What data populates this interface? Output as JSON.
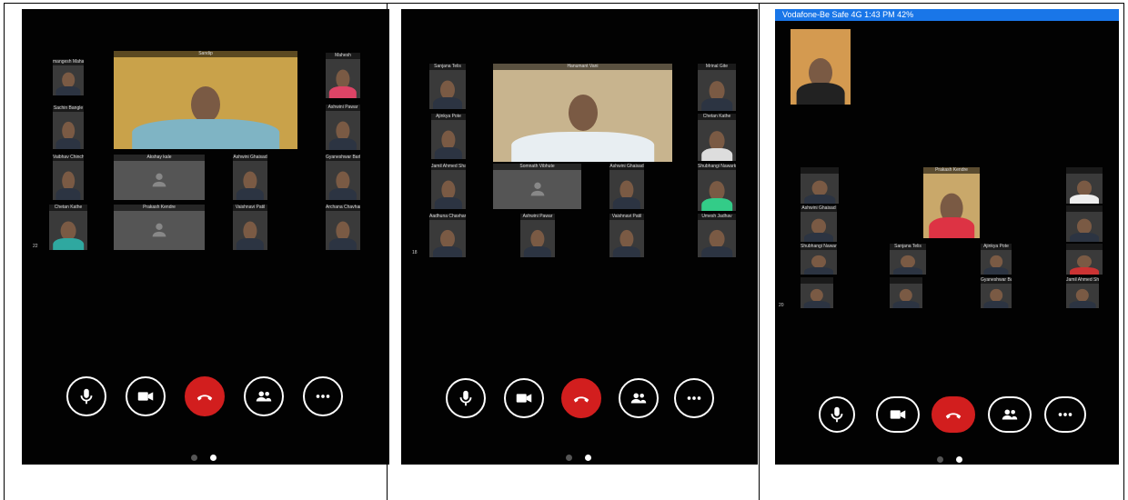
{
  "panels": [
    {
      "id": "p1",
      "main_speaker": "Sandip",
      "participants": [
        "mangesh Mahale",
        "Sachin Bangle",
        "Vaibhav Chinchole",
        "Chetan Kathe",
        "Mahesh",
        "Ashwini Pawar",
        "Gyaneshwar Barkale",
        "Archana Chavhan",
        "Akshay kale",
        "Ashwini Ghaisad",
        "Prakash Kendre",
        "Vaishnavi Patil"
      ],
      "count": "22"
    },
    {
      "id": "p2",
      "main_speaker": "Hanumant Vani",
      "participants": [
        "Sanjana Telis",
        "Mrinal Gite",
        "Ajinkya Pote",
        "Chetan Kathe",
        "Jamil Ahmed Shakh Khalil",
        "Somnath Vibhute",
        "Ashwini Ghaisad",
        "Shubhangi Nawarkhele",
        "Aadhuna Chavhan",
        "Ashwini Pawar",
        "Vaishnavi Patil",
        "Umesh Jadhav"
      ],
      "count": "18"
    },
    {
      "id": "p3",
      "status_bar": "Vodafone-Be Safe  4G  1:43 PM  42%",
      "main_speaker": "Prakash Kendre",
      "participants": [
        "Ashwini Ghaisad",
        "Shubhangi Nawarkhele",
        "Sanjana Telis",
        "Ajinkya Pote",
        "Chetan Kathe",
        "Jamil Ahmed Shakh Khalil",
        "Gyaneshwar Barkale"
      ],
      "count": "20"
    }
  ],
  "controls": [
    "mic",
    "video",
    "end-call",
    "participants",
    "more"
  ],
  "colors": {
    "end": "#d21e1e",
    "status": "#1976e8"
  }
}
